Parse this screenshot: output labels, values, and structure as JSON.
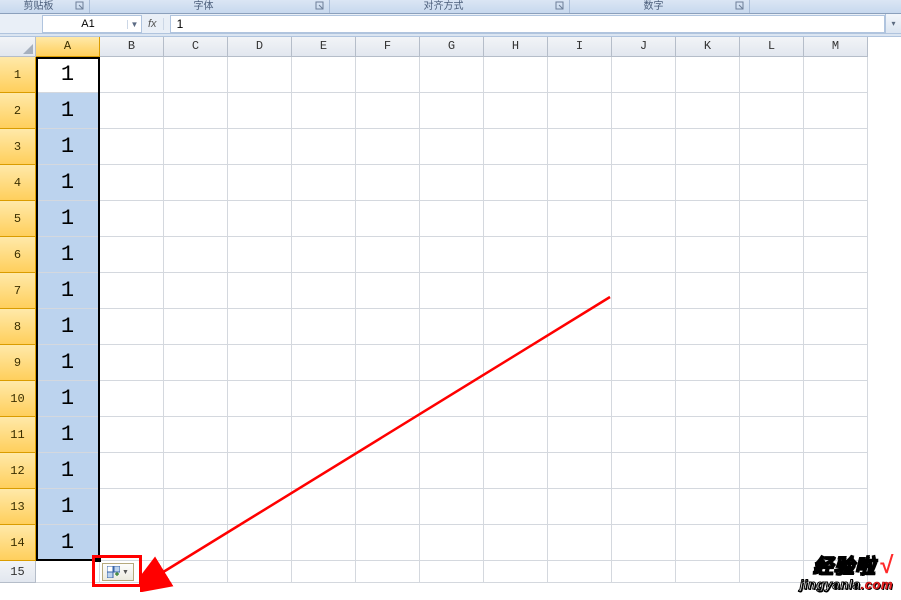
{
  "ribbon_groups": {
    "clipboard": "剪贴板",
    "font": "字体",
    "alignment": "对齐方式",
    "number": "数字"
  },
  "namebox": {
    "value": "A1"
  },
  "formula": {
    "fx_label": "fx",
    "value": "1"
  },
  "columns": [
    "A",
    "B",
    "C",
    "D",
    "E",
    "F",
    "G",
    "H",
    "I",
    "J",
    "K",
    "L",
    "M"
  ],
  "selected_column_index": 0,
  "rows": [
    "1",
    "2",
    "3",
    "4",
    "5",
    "6",
    "7",
    "8",
    "9",
    "10",
    "11",
    "12",
    "13",
    "14",
    "15"
  ],
  "selected_rows_start": 0,
  "selected_rows_end": 13,
  "column_A_values": [
    "1",
    "1",
    "1",
    "1",
    "1",
    "1",
    "1",
    "1",
    "1",
    "1",
    "1",
    "1",
    "1",
    "1"
  ],
  "autofill": {
    "tooltip": "自动填充选项"
  },
  "watermark": {
    "title": "经验啦",
    "site_prefix": "jingyanla",
    "site_suffix": ".com"
  },
  "colors": {
    "selection_fill": "#bcd3ee",
    "header_selected": "#ffcf5c",
    "annotation": "#ff0000"
  }
}
